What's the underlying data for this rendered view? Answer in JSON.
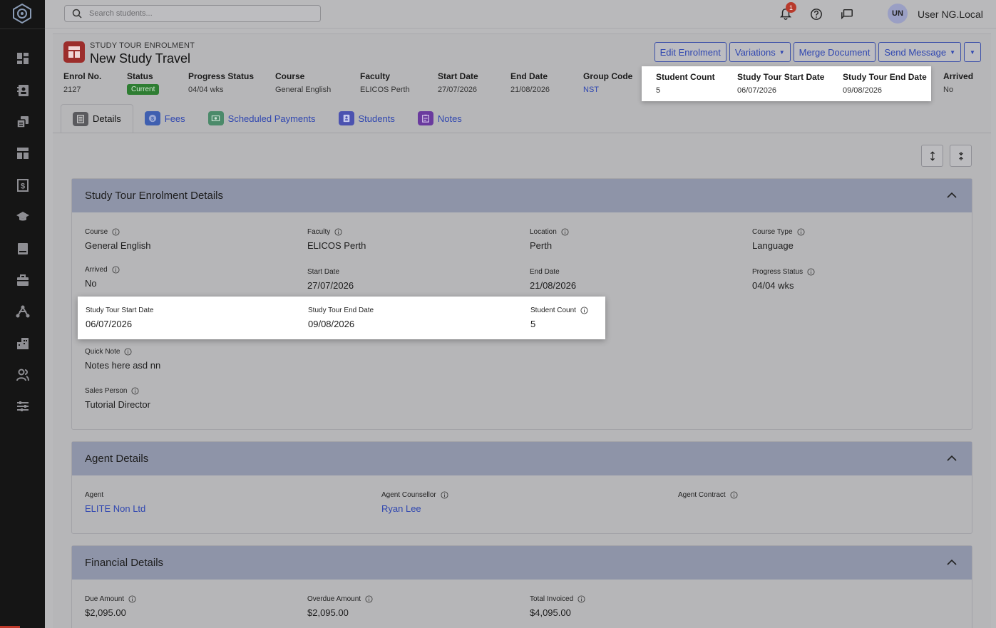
{
  "topbar": {
    "search_placeholder": "Search students...",
    "notification_count": "1",
    "avatar_initials": "UN",
    "user_name": "User NG.Local"
  },
  "sidebar": {
    "items": [
      {
        "icon": "dashboard-icon"
      },
      {
        "icon": "contacts-icon"
      },
      {
        "icon": "copy-icon"
      },
      {
        "icon": "layout-icon"
      },
      {
        "icon": "invoice-icon"
      },
      {
        "icon": "graduation-cap-icon"
      },
      {
        "icon": "book-icon"
      },
      {
        "icon": "briefcase-icon"
      },
      {
        "icon": "network-icon"
      },
      {
        "icon": "building-icon"
      },
      {
        "icon": "people-icon"
      },
      {
        "icon": "sliders-icon"
      }
    ]
  },
  "header": {
    "subtitle": "STUDY TOUR ENROLMENT",
    "title": "New Study Travel",
    "actions": {
      "edit": "Edit Enrolment",
      "variations": "Variations",
      "merge": "Merge Document",
      "send": "Send Message"
    },
    "stats": [
      {
        "label": "Enrol No.",
        "value": "2127"
      },
      {
        "label": "Status",
        "value": "Current"
      },
      {
        "label": "Progress Status",
        "value": "04/04 wks"
      },
      {
        "label": "Course",
        "value": "General English"
      },
      {
        "label": "Faculty",
        "value": "ELICOS Perth"
      },
      {
        "label": "Start Date",
        "value": "27/07/2026"
      },
      {
        "label": "End Date",
        "value": "21/08/2026"
      },
      {
        "label": "Group Code",
        "value": "NST"
      },
      {
        "label": "Student Count",
        "value": "5"
      },
      {
        "label": "Study Tour Start Date",
        "value": "06/07/2026"
      },
      {
        "label": "Study Tour End Date",
        "value": "09/08/2026"
      },
      {
        "label": "Arrived",
        "value": "No"
      }
    ]
  },
  "tabs": [
    {
      "label": "Details",
      "icon": "document-icon",
      "color": "#5a5a5e"
    },
    {
      "label": "Fees",
      "icon": "dollar-circle-icon",
      "color": "#3f5fb0"
    },
    {
      "label": "Scheduled Payments",
      "icon": "cash-icon",
      "color": "#4b8a6a"
    },
    {
      "label": "Students",
      "icon": "student-card-icon",
      "color": "#4b52b0"
    },
    {
      "label": "Notes",
      "icon": "clipboard-icon",
      "color": "#6a3a9e"
    }
  ],
  "sections": {
    "enrolment": {
      "title": "Study Tour Enrolment Details",
      "fields": [
        {
          "label": "Course",
          "value": "General English"
        },
        {
          "label": "Faculty",
          "value": "ELICOS Perth"
        },
        {
          "label": "Location",
          "value": "Perth"
        },
        {
          "label": "Course Type",
          "value": "Language"
        },
        {
          "label": "Arrived",
          "value": "No"
        },
        {
          "label": "Start Date",
          "value": "27/07/2026"
        },
        {
          "label": "End Date",
          "value": "21/08/2026"
        },
        {
          "label": "Progress Status",
          "value": "04/04 wks"
        },
        {
          "label": "Study Tour Start Date",
          "value": "06/07/2026"
        },
        {
          "label": "Study Tour End Date",
          "value": "09/08/2026"
        },
        {
          "label": "Student Count",
          "value": "5"
        },
        {
          "label": "Quick Note",
          "value": "Notes here asd nn"
        },
        {
          "label": "Sales Person",
          "value": "Tutorial Director"
        }
      ]
    },
    "agent": {
      "title": "Agent Details",
      "fields": [
        {
          "label": "Agent",
          "value": "ELITE Non Ltd"
        },
        {
          "label": "Agent Counsellor",
          "value": "Ryan Lee"
        },
        {
          "label": "Agent Contract",
          "value": ""
        }
      ]
    },
    "financial": {
      "title": "Financial Details",
      "fields": [
        {
          "label": "Due Amount",
          "value": "$2,095.00"
        },
        {
          "label": "Overdue Amount",
          "value": "$2,095.00"
        },
        {
          "label": "Total Invoiced",
          "value": "$4,095.00"
        }
      ]
    }
  },
  "colors": {
    "accent": "#2f46b0",
    "status_current": "#2e7d32",
    "section_header": "#8e94a8",
    "entity_icon": "#9c2d2b"
  }
}
